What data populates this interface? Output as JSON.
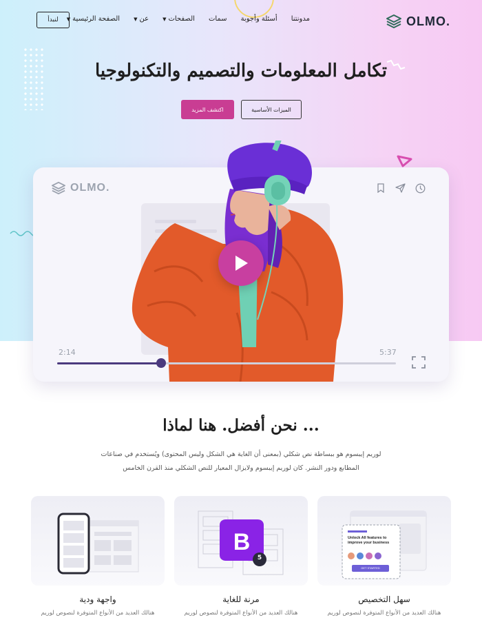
{
  "brand": {
    "name": "OLMO."
  },
  "nav": {
    "items": [
      {
        "label": "الصفحة الرئيسية",
        "dropdown": true
      },
      {
        "label": "عن",
        "dropdown": true
      },
      {
        "label": "الصفحات",
        "dropdown": true
      },
      {
        "label": "سمات",
        "dropdown": false
      },
      {
        "label": "أسئلة وأجوبة",
        "dropdown": false
      },
      {
        "label": "مدونتنا",
        "dropdown": false
      }
    ],
    "cta": "لنبدأ"
  },
  "hero": {
    "title": "تكامل المعلومات والتصميم والتكنولوجيا",
    "btn_outline": "الميزات الأساسية",
    "btn_primary": "اكتشف المزيد"
  },
  "player": {
    "logo": "OLMO.",
    "time_elapsed": "2:14",
    "time_total": "5:37",
    "progress": 0.307,
    "icons": [
      "bookmark-icon",
      "send-icon",
      "clock-icon"
    ]
  },
  "why": {
    "title": "... نحن أفضل. هنا لماذا",
    "text": "لوريم إيبسوم هو ببساطة نص شكلي (بمعنى أن الغاية هي الشكل وليس المحتوى) ويُستخدم في صناعات المطابع ودور النشر. كان لوريم إيبسوم ولايزال المعيار للنص الشكلي منذ القرن الخامس"
  },
  "features": [
    {
      "title": "سهل التخصيص",
      "text": "هنالك العديد من الأنواع المتوفرة لنصوص لوريم",
      "mockup": {
        "heading": "Unlock All features to improve your business",
        "button": "GET STARTED"
      }
    },
    {
      "title": "مرنة للغاية",
      "text": "هنالك العديد من الأنواع المتوفرة لنصوص لوريم",
      "badge": "5"
    },
    {
      "title": "واجهة ودية",
      "text": "هنالك العديد من الأنواع المتوفرة لنصوص لوريم"
    }
  ],
  "colors": {
    "accent": "#c93d93",
    "progress": "#4b3a7e",
    "heading": "#1f1f1f"
  }
}
